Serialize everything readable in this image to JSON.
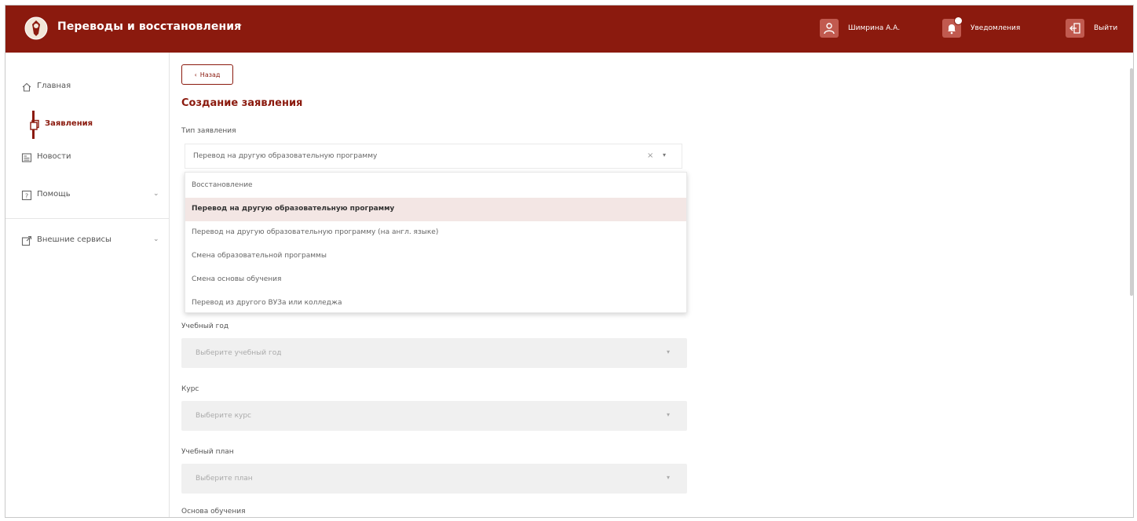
{
  "header": {
    "app_title": "Переводы и восстановления",
    "user_label": "Шимрина А.А.",
    "notifications_label": "Уведомления",
    "logout_label": "Выйти"
  },
  "sidebar": {
    "items": [
      {
        "label": "Главная",
        "icon": "home-icon"
      },
      {
        "label": "Заявления",
        "icon": "documents-icon",
        "active": true
      },
      {
        "label": "Новости",
        "icon": "news-icon"
      },
      {
        "label": "Помощь",
        "icon": "help-icon"
      },
      {
        "label": "Внешние сервисы",
        "icon": "external-link-icon"
      }
    ]
  },
  "main": {
    "back_label": "Назад",
    "page_title": "Создание заявления",
    "type_field": {
      "label": "Тип заявления",
      "value": "Перевод на другую образовательную программу",
      "options": [
        "Восстановление",
        "Перевод на другую образовательную программу",
        "Перевод на другую образовательную программу (на англ. языке)",
        "Смена образовательной программы",
        "Смена основы обучения",
        "Перевод из другого ВУЗа или колледжа"
      ]
    },
    "year_field": {
      "label": "Учебный год",
      "placeholder": "Выберите учебный год"
    },
    "course_field": {
      "label": "Курс",
      "placeholder": "Выберите курс"
    },
    "plan_field": {
      "label": "Учебный план",
      "placeholder": "Выберите план"
    },
    "basis_field": {
      "label": "Основа обучения"
    }
  },
  "colors": {
    "brand": "#8b1a0e",
    "header_icon_bg": "#c15a4f",
    "selected_option_bg": "#f3e6e4"
  }
}
